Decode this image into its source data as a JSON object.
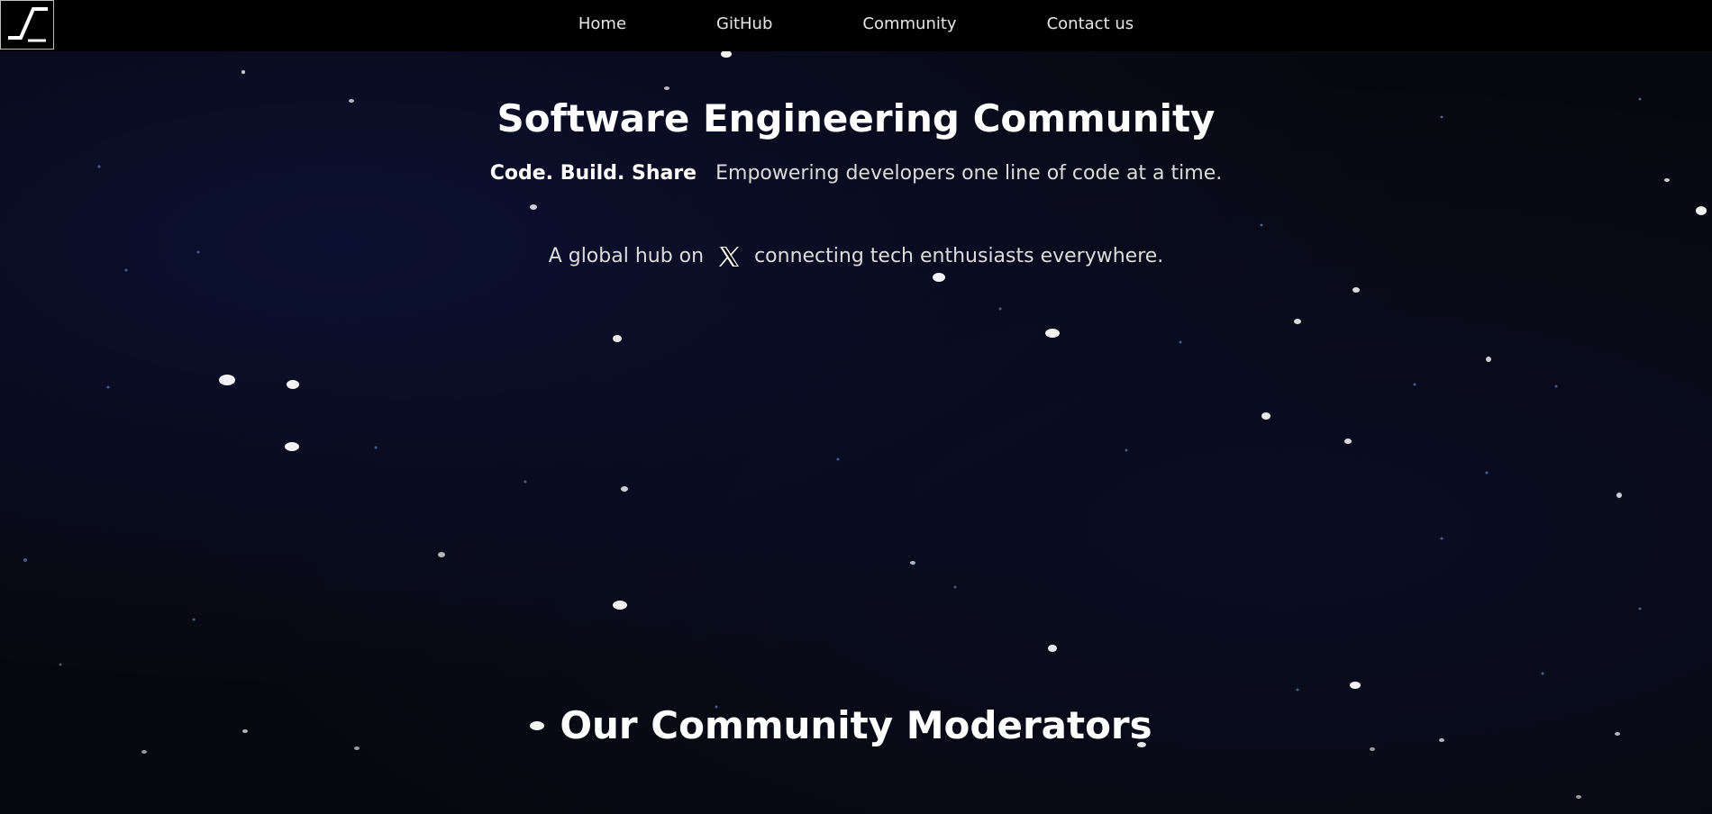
{
  "nav": {
    "logo_icon": "signal-step-logo-icon",
    "links": [
      "Home",
      "GitHub",
      "Community",
      "Contact us"
    ]
  },
  "hero": {
    "title": "Software Engineering Community",
    "tagline_bold": "Code. Build. Share",
    "tagline_text": "Empowering developers one line of code at a time.",
    "hub_prefix": "A global hub on",
    "hub_icon": "x-logo-icon",
    "hub_suffix": "connecting tech enthusiasts everywhere."
  },
  "moderators": {
    "title": "Our Community Moderators"
  },
  "colors": {
    "background": "#07080f",
    "navbar": "#000000",
    "text": "#ffffff",
    "muted_text": "#dcdcdc"
  }
}
